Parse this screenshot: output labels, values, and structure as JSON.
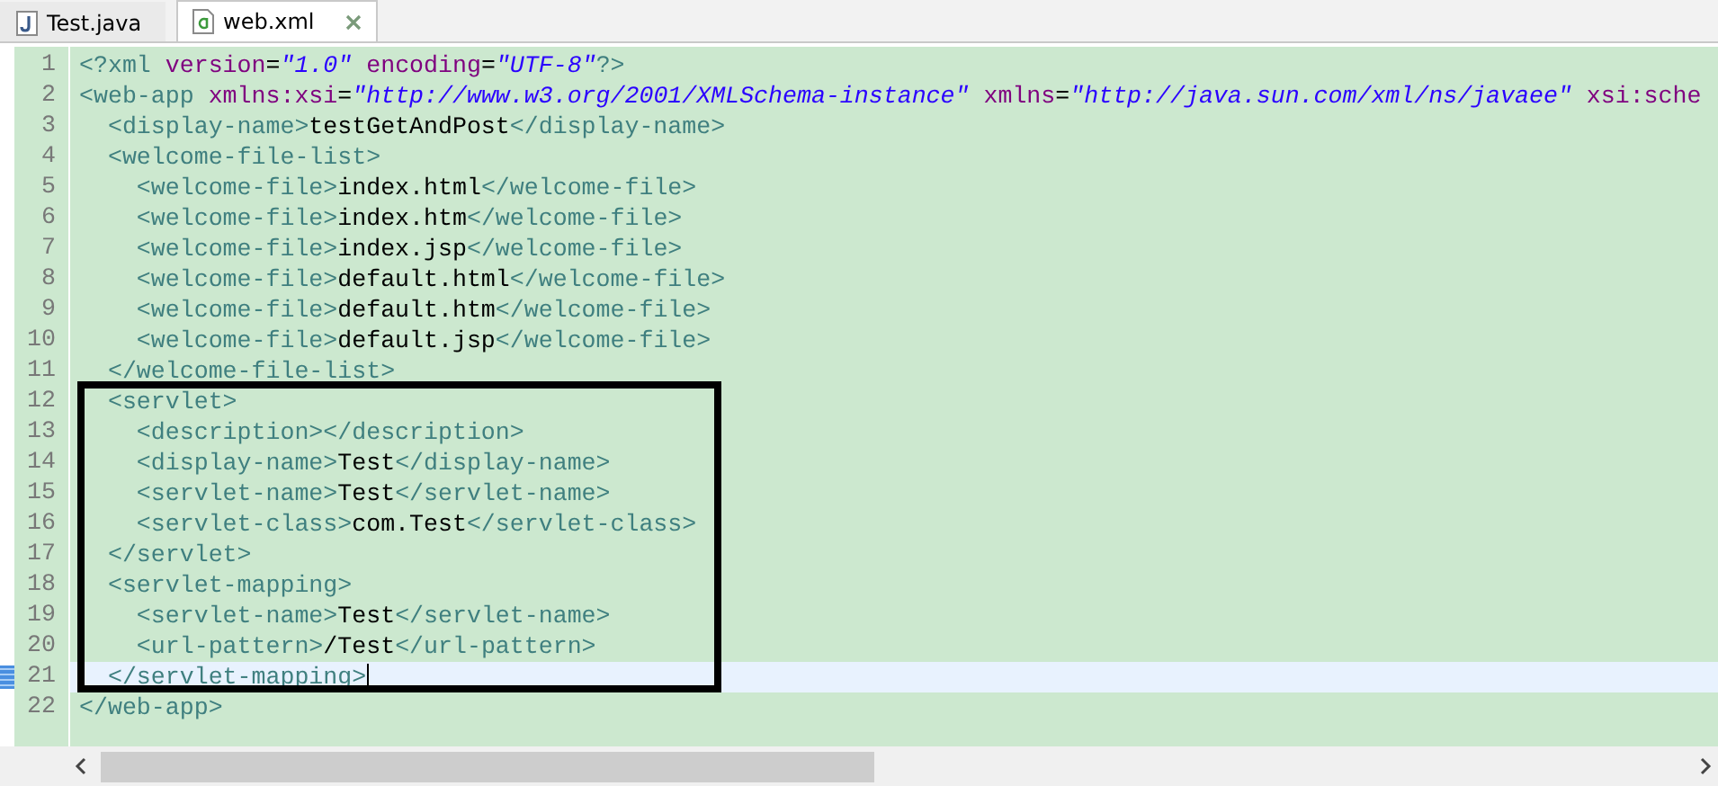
{
  "tabs": [
    {
      "label": "Test.java",
      "kind": "java",
      "selected": false
    },
    {
      "label": "web.xml",
      "kind": "xml",
      "selected": true
    }
  ],
  "editor": {
    "lines": [
      {
        "number": "1",
        "current": false,
        "tokens": [
          {
            "kind": "tag",
            "text": "<?xml"
          },
          {
            "kind": "attr",
            "text": " version"
          },
          {
            "kind": "text",
            "text": "="
          },
          {
            "kind": "value",
            "text": "\"1.0\""
          },
          {
            "kind": "attr",
            "text": " encoding"
          },
          {
            "kind": "text",
            "text": "="
          },
          {
            "kind": "value",
            "text": "\"UTF-8\""
          },
          {
            "kind": "tag",
            "text": "?>"
          }
        ]
      },
      {
        "number": "2",
        "current": false,
        "tokens": [
          {
            "kind": "tag",
            "text": "<web-app"
          },
          {
            "kind": "attr",
            "text": " xmlns:xsi"
          },
          {
            "kind": "text",
            "text": "="
          },
          {
            "kind": "value",
            "text": "\"http://www.w3.org/2001/XMLSchema-instance\""
          },
          {
            "kind": "attr",
            "text": " xmlns"
          },
          {
            "kind": "text",
            "text": "="
          },
          {
            "kind": "value",
            "text": "\"http://java.sun.com/xml/ns/javaee\""
          },
          {
            "kind": "attr",
            "text": " xsi:sche"
          }
        ]
      },
      {
        "number": "3",
        "current": false,
        "tokens": [
          {
            "kind": "tag",
            "text": "  <display-name>"
          },
          {
            "kind": "text",
            "text": "testGetAndPost"
          },
          {
            "kind": "tag",
            "text": "</display-name>"
          }
        ]
      },
      {
        "number": "4",
        "current": false,
        "tokens": [
          {
            "kind": "tag",
            "text": "  <welcome-file-list>"
          }
        ]
      },
      {
        "number": "5",
        "current": false,
        "tokens": [
          {
            "kind": "tag",
            "text": "    <welcome-file>"
          },
          {
            "kind": "text",
            "text": "index.html"
          },
          {
            "kind": "tag",
            "text": "</welcome-file>"
          }
        ]
      },
      {
        "number": "6",
        "current": false,
        "tokens": [
          {
            "kind": "tag",
            "text": "    <welcome-file>"
          },
          {
            "kind": "text",
            "text": "index.htm"
          },
          {
            "kind": "tag",
            "text": "</welcome-file>"
          }
        ]
      },
      {
        "number": "7",
        "current": false,
        "tokens": [
          {
            "kind": "tag",
            "text": "    <welcome-file>"
          },
          {
            "kind": "text",
            "text": "index.jsp"
          },
          {
            "kind": "tag",
            "text": "</welcome-file>"
          }
        ]
      },
      {
        "number": "8",
        "current": false,
        "tokens": [
          {
            "kind": "tag",
            "text": "    <welcome-file>"
          },
          {
            "kind": "text",
            "text": "default.html"
          },
          {
            "kind": "tag",
            "text": "</welcome-file>"
          }
        ]
      },
      {
        "number": "9",
        "current": false,
        "tokens": [
          {
            "kind": "tag",
            "text": "    <welcome-file>"
          },
          {
            "kind": "text",
            "text": "default.htm"
          },
          {
            "kind": "tag",
            "text": "</welcome-file>"
          }
        ]
      },
      {
        "number": "10",
        "current": false,
        "tokens": [
          {
            "kind": "tag",
            "text": "    <welcome-file>"
          },
          {
            "kind": "text",
            "text": "default.jsp"
          },
          {
            "kind": "tag",
            "text": "</welcome-file>"
          }
        ]
      },
      {
        "number": "11",
        "current": false,
        "tokens": [
          {
            "kind": "tag",
            "text": "  </welcome-file-list>"
          }
        ]
      },
      {
        "number": "12",
        "current": false,
        "tokens": [
          {
            "kind": "tag",
            "text": "  <servlet>"
          }
        ]
      },
      {
        "number": "13",
        "current": false,
        "tokens": [
          {
            "kind": "tag",
            "text": "    <description></description>"
          }
        ]
      },
      {
        "number": "14",
        "current": false,
        "tokens": [
          {
            "kind": "tag",
            "text": "    <display-name>"
          },
          {
            "kind": "text",
            "text": "Test"
          },
          {
            "kind": "tag",
            "text": "</display-name>"
          }
        ]
      },
      {
        "number": "15",
        "current": false,
        "tokens": [
          {
            "kind": "tag",
            "text": "    <servlet-name>"
          },
          {
            "kind": "text",
            "text": "Test"
          },
          {
            "kind": "tag",
            "text": "</servlet-name>"
          }
        ]
      },
      {
        "number": "16",
        "current": false,
        "tokens": [
          {
            "kind": "tag",
            "text": "    <servlet-class>"
          },
          {
            "kind": "text",
            "text": "com.Test"
          },
          {
            "kind": "tag",
            "text": "</servlet-class>"
          }
        ]
      },
      {
        "number": "17",
        "current": false,
        "tokens": [
          {
            "kind": "tag",
            "text": "  </servlet>"
          }
        ]
      },
      {
        "number": "18",
        "current": false,
        "tokens": [
          {
            "kind": "tag",
            "text": "  <servlet-mapping>"
          }
        ]
      },
      {
        "number": "19",
        "current": false,
        "tokens": [
          {
            "kind": "tag",
            "text": "    <servlet-name>"
          },
          {
            "kind": "text",
            "text": "Test"
          },
          {
            "kind": "tag",
            "text": "</servlet-name>"
          }
        ]
      },
      {
        "number": "20",
        "current": false,
        "tokens": [
          {
            "kind": "tag",
            "text": "    <url-pattern>"
          },
          {
            "kind": "text",
            "text": "/Test"
          },
          {
            "kind": "tag",
            "text": "</url-pattern>"
          }
        ]
      },
      {
        "number": "21",
        "current": true,
        "tokens": [
          {
            "kind": "tag",
            "text": "  </servlet-mapping>"
          }
        ]
      },
      {
        "number": "22",
        "current": false,
        "tokens": [
          {
            "kind": "tag",
            "text": "</web-app>"
          }
        ]
      }
    ]
  }
}
